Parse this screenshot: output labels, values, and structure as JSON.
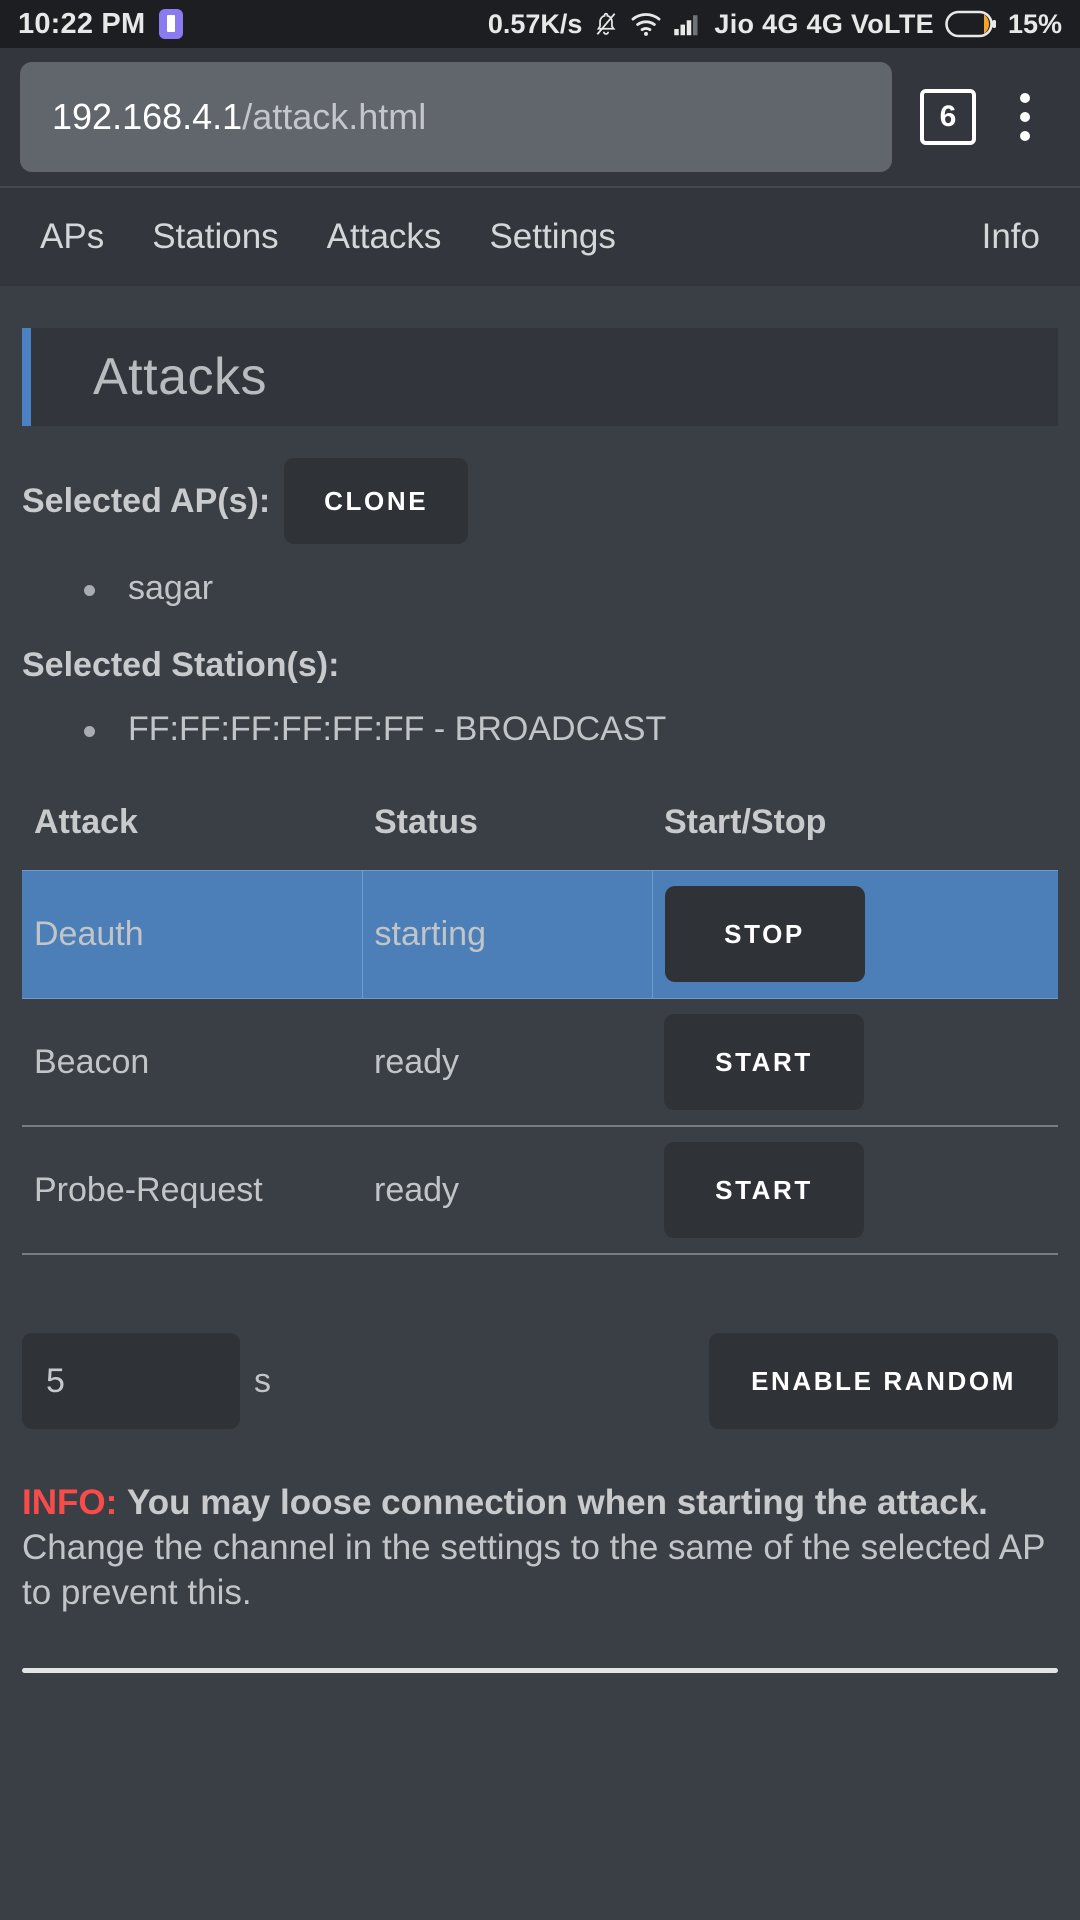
{
  "statusbar": {
    "clock": "10:22 PM",
    "app_icon": "app-badge-icon",
    "network_speed": "0.57K/s",
    "bell_icon": "bell-muted-icon",
    "wifi_icon": "wifi-icon",
    "signal_icon": "signal-bars-icon",
    "carrier": "Jio 4G 4G VoLTE",
    "battery_icon": "battery-icon",
    "battery_percent": "15%"
  },
  "browser": {
    "url_host": "192.168.4.1",
    "url_path": "/attack.html",
    "tab_count": "6",
    "menu_icon": "kebab-menu-icon"
  },
  "nav": {
    "items": [
      {
        "label": "APs"
      },
      {
        "label": "Stations"
      },
      {
        "label": "Attacks"
      },
      {
        "label": "Settings"
      }
    ],
    "right_item": {
      "label": "Info"
    }
  },
  "page": {
    "title": "Attacks",
    "accent_color": "#4c82c3"
  },
  "selection": {
    "ap_label": "Selected AP(s):",
    "clone_button": "CLONE",
    "ap_list": [
      "sagar"
    ],
    "station_label": "Selected Station(s):",
    "station_list": [
      "FF:FF:FF:FF:FF:FF - BROADCAST"
    ]
  },
  "attack_table": {
    "headers": {
      "attack": "Attack",
      "status": "Status",
      "control": "Start/Stop"
    },
    "rows": [
      {
        "attack": "Deauth",
        "status": "starting",
        "status_color": "#fa4b4b",
        "button": "STOP",
        "active": true
      },
      {
        "attack": "Beacon",
        "status": "ready",
        "status_color": "#2fcf81",
        "button": "START",
        "active": false
      },
      {
        "attack": "Probe-Request",
        "status": "ready",
        "status_color": "#2fcf81",
        "button": "START",
        "active": false
      }
    ]
  },
  "random": {
    "interval_value": "5",
    "interval_placeholder": "5",
    "unit": "s",
    "button": "ENABLE RANDOM"
  },
  "info": {
    "tag": "INFO:",
    "bold_text": "You may loose connection when starting the attack.",
    "rest_text": " Change the channel in the settings to the same of the selected AP to prevent this."
  }
}
